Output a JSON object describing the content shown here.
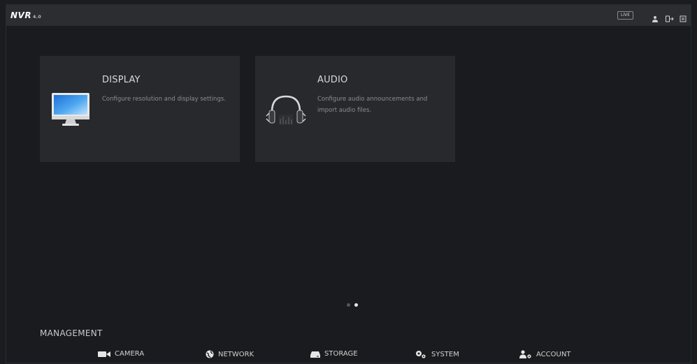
{
  "header": {
    "logo": "NVR",
    "logo_version": "4.0",
    "live_label": "LIVE",
    "icons": [
      "user-icon",
      "logout-icon",
      "menu-icon"
    ]
  },
  "cards": [
    {
      "title": "DISPLAY",
      "description": "Configure resolution and display settings.",
      "icon": "monitor-icon"
    },
    {
      "title": "AUDIO",
      "description": "Configure audio announcements and import audio files.",
      "icon": "headphones-icon"
    }
  ],
  "pager": {
    "pages": 2,
    "active_page": 2
  },
  "management": {
    "title": "MANAGEMENT",
    "items": [
      {
        "label": "CAMERA",
        "icon": "camera-icon"
      },
      {
        "label": "NETWORK",
        "icon": "network-globe-icon"
      },
      {
        "label": "STORAGE",
        "icon": "storage-icon"
      },
      {
        "label": "SYSTEM",
        "icon": "gears-icon"
      },
      {
        "label": "ACCOUNT",
        "icon": "account-icon"
      }
    ]
  },
  "colors": {
    "background": "#1b1c20",
    "card": "#28292d",
    "topbar": "#2c2d31",
    "text": "#d0d0d0",
    "muted_text": "#8d8d8d"
  }
}
